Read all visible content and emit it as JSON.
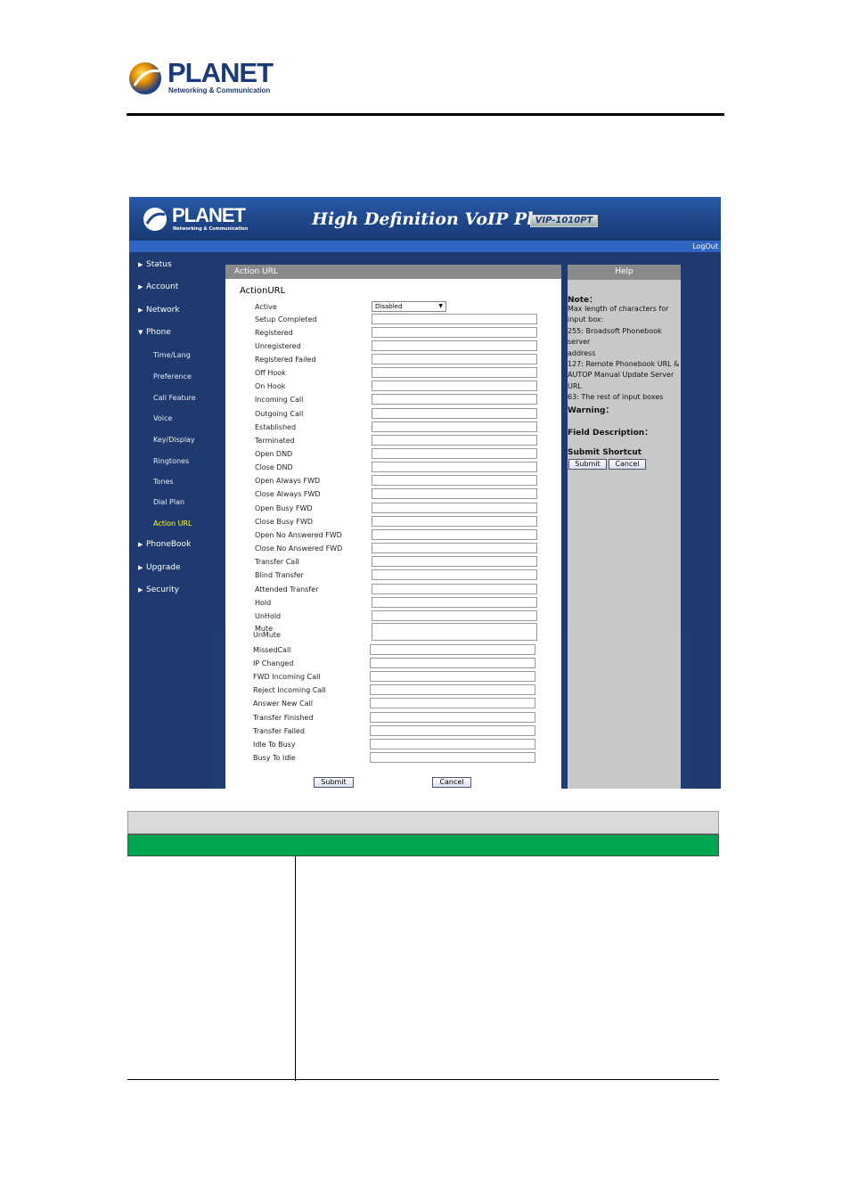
{
  "document_logo": {
    "brand": "PLANET",
    "tagline": "Networking & Communication"
  },
  "banner": {
    "logo_brand": "PLANET",
    "logo_tagline": "Networking & Communication",
    "title": "High Definition VoIP Phone",
    "model": "VIP-1010PT",
    "logout": "LogOut"
  },
  "sidebar": {
    "items": [
      {
        "label": "Status",
        "arrow": "▶"
      },
      {
        "label": "Account",
        "arrow": "▶"
      },
      {
        "label": "Network",
        "arrow": "▶"
      },
      {
        "label": "Phone",
        "arrow": "▼"
      },
      {
        "label": "PhoneBook",
        "arrow": "▶"
      },
      {
        "label": "Upgrade",
        "arrow": "▶"
      },
      {
        "label": "Security",
        "arrow": "▶"
      }
    ],
    "phone_subitems": [
      "Time/Lang",
      "Preference",
      "Call Feature",
      "Voice",
      "Key/Display",
      "Ringtones",
      "Tones",
      "Dial Plan",
      "Action URL"
    ],
    "active_subitem": "Action URL"
  },
  "main": {
    "header": "Action URL",
    "section_title": "ActionURL",
    "active_label": "Active",
    "active_value": "Disabled",
    "dropdown_arrow": "▼",
    "fields": [
      "Setup Completed",
      "Registered",
      "Unregistered",
      "Registered Failed",
      "Off Hook",
      "On Hook",
      "Incoming Call",
      "Outgoing Call",
      "Established",
      "Terminated",
      "Open DND",
      "Close DND",
      "Open Always FWD",
      "Close Always FWD",
      "Open Busy FWD",
      "Close Busy FWD",
      "Open No Answered FWD",
      "Close No Answered FWD",
      "Transfer Call",
      "Blind Transfer",
      "Attended Transfer",
      "Hold",
      "UnHold",
      "Mute",
      "UnMute",
      "MissedCall",
      "IP Changed",
      "FWD Incoming Call",
      "Reject Incoming Call",
      "Answer New Call",
      "Transfer Finished",
      "Transfer Failed",
      "Idle To Busy",
      "Busy To Idle"
    ],
    "submit_label": "Submit",
    "cancel_label": "Cancel"
  },
  "help": {
    "header": "Help",
    "note_title": "Note：",
    "note_lines": [
      "Max length of characters for",
      "input box:",
      "255: Broadsoft Phonebook server",
      "address",
      "127: Remote Phonebook URL &",
      "AUTOP Manual Update Server",
      "URL",
      "63: The rest of input boxes"
    ],
    "warning_title": "Warning：",
    "field_desc_title": "Field Description：",
    "shortcut_title": "Submit Shortcut",
    "submit_label": "Submit",
    "cancel_label": "Cancel"
  },
  "colors": {
    "nav_bg": "#1e3a6e",
    "active_item": "#ffff33",
    "table_green": "#00a651",
    "panel_header": "#8a8a8a"
  }
}
